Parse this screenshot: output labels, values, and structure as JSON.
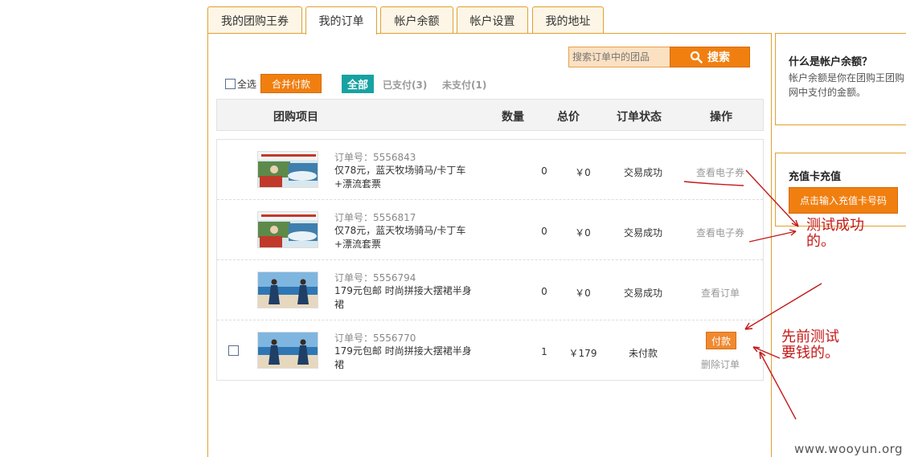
{
  "tabs": [
    {
      "label": "我的团购王券",
      "active": false
    },
    {
      "label": "我的订单",
      "active": true
    },
    {
      "label": "帐户余额",
      "active": false
    },
    {
      "label": "帐户设置",
      "active": false
    },
    {
      "label": "我的地址",
      "active": false
    }
  ],
  "search": {
    "placeholder": "搜索订单中的团品",
    "button_label": "搜索"
  },
  "toolbar": {
    "select_all_label": "全选",
    "merge_pay_label": "合并付款",
    "filter_all_label": "全部",
    "filter_paid_label": "已支付(3)",
    "filter_unpaid_label": "未支付(1)"
  },
  "table": {
    "headers": {
      "item": "团购项目",
      "qty": "数量",
      "total": "总价",
      "status": "订单状态",
      "action": "操作"
    },
    "rows": [
      {
        "order_no": "订单号：5556843",
        "title": "仅78元，蓝天牧场骑马/卡丁车+漂流套票",
        "qty": "0",
        "price": "￥0",
        "status": "交易成功",
        "action": "查看电子券",
        "thumb": "water-park"
      },
      {
        "order_no": "订单号：5556817",
        "title": "仅78元，蓝天牧场骑马/卡丁车+漂流套票",
        "qty": "0",
        "price": "￥0",
        "status": "交易成功",
        "action": "查看电子券",
        "thumb": "water-park"
      },
      {
        "order_no": "订单号：5556794",
        "title": "179元包邮 时尚拼接大摆裙半身裙",
        "qty": "0",
        "price": "￥0",
        "status": "交易成功",
        "action": "查看订单",
        "thumb": "beach-dress"
      },
      {
        "order_no": "订单号：5556770",
        "title": "179元包邮 时尚拼接大摆裙半身裙",
        "qty": "1",
        "price": "￥179",
        "status": "未付款",
        "action": "付款",
        "delete_label": "删除订单",
        "thumb": "beach-dress"
      }
    ]
  },
  "sidebar": {
    "balance_title": "什么是帐户余额？",
    "balance_text": "帐户余额是你在团购王团购网中支付的金额。",
    "recharge_title": "充值卡充值",
    "recharge_button": "点击输入充值卡号码"
  },
  "annotations": {
    "success_note": "测试成功的。",
    "success_note_line1": "测试成功",
    "success_note_line2": "的。",
    "cost_note_line1": "先前测试",
    "cost_note_line2": "要钱的。",
    "color": "#c41a1a"
  },
  "watermark": "www.wooyun.org",
  "colors": {
    "accent_orange": "#f07f10",
    "tab_border": "#e0a030",
    "filter_active": "#17a2a2"
  }
}
